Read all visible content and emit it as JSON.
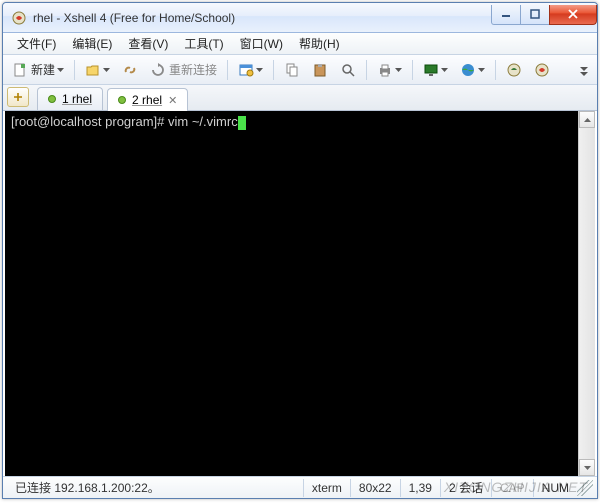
{
  "window": {
    "title": "rhel - Xshell 4 (Free for Home/School)"
  },
  "menu": {
    "file": "文件(F)",
    "edit": "编辑(E)",
    "view": "查看(V)",
    "tools": "工具(T)",
    "window": "窗口(W)",
    "help": "帮助(H)"
  },
  "toolbar": {
    "new_label": "新建",
    "reconnect_label": "重新连接"
  },
  "tabs": [
    {
      "label": "1 rhel",
      "active": false
    },
    {
      "label": "2 rhel",
      "active": true
    }
  ],
  "terminal": {
    "prompt": "[root@localhost program]# ",
    "command": "vim ~/.vimrc"
  },
  "status": {
    "connection": "已连接 192.168.1.200:22。",
    "term": "xterm",
    "size": "80x22",
    "pos": "1,39",
    "sessions": "2 会话",
    "cap": "CAP",
    "num": "NUM"
  },
  "watermark": "XITONGZHIJIA.NET",
  "colors": {
    "cursor": "#4ae24a"
  }
}
